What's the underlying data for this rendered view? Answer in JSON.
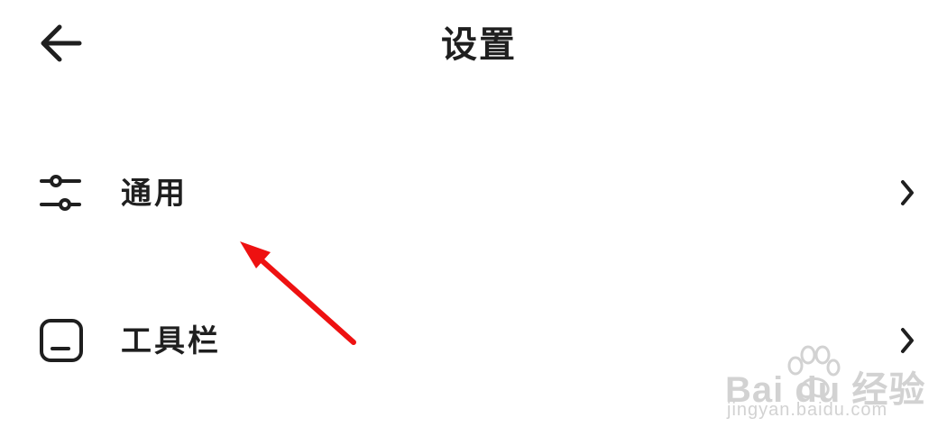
{
  "header": {
    "title": "设置",
    "back_icon": "arrow-left-icon"
  },
  "menu": [
    {
      "label": "通用",
      "icon": "sliders-icon",
      "chevron": "chevron-right-icon"
    },
    {
      "label": "工具栏",
      "icon": "toolbar-icon",
      "chevron": "chevron-right-icon"
    }
  ],
  "annotation": {
    "arrow_color": "#ee1111"
  },
  "watermark": {
    "brand": "Bai  du 经验",
    "url": "jingyan.baidu.com"
  },
  "colors": {
    "text": "#1f1f1f",
    "background": "#ffffff",
    "watermark": "#d2d2d2"
  }
}
